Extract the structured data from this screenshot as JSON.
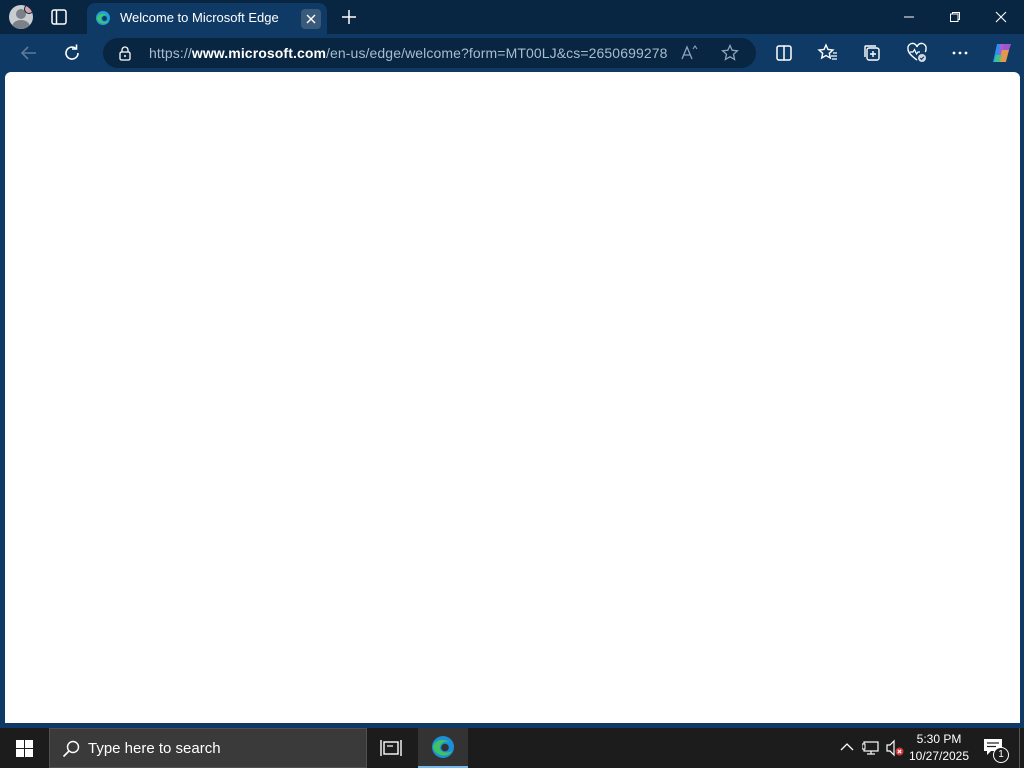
{
  "browser": {
    "tab": {
      "title": "Welcome to Microsoft Edge",
      "favicon": "edge-icon"
    },
    "address_bar": {
      "url_prefix": "https://",
      "url_domain": "www.microsoft.com",
      "url_path": "/en-us/edge/welcome?form=MT00LJ&cs=2650699278"
    },
    "toolbar_icons": [
      "back-icon",
      "refresh-icon",
      "lock-icon",
      "read-aloud-icon",
      "favorite-star-icon",
      "split-screen-icon",
      "favorites-icon",
      "collections-icon",
      "browser-essentials-icon",
      "more-icon",
      "copilot-icon"
    ],
    "window_controls": [
      "minimize-icon",
      "restore-icon",
      "close-icon"
    ]
  },
  "taskbar": {
    "search_placeholder": "Type here to search",
    "clock_time": "5:30 PM",
    "clock_date": "10/27/2025",
    "notification_count": "1",
    "tray_icons": [
      "chevron-up-icon",
      "network-icon",
      "volume-muted-icon"
    ]
  },
  "colors": {
    "titlebar": "#082541",
    "toolbar": "#0f3a66",
    "taskbar": "#1c1c1c",
    "accent": "#76b9ed"
  }
}
